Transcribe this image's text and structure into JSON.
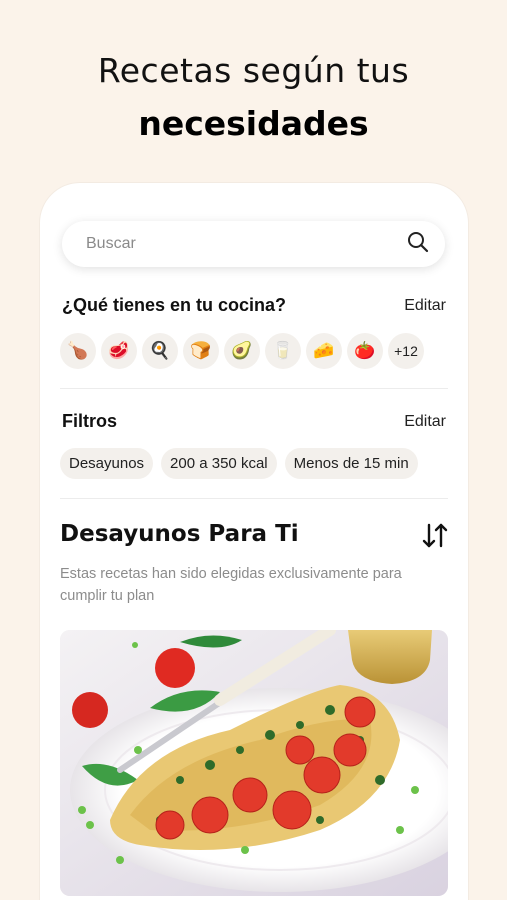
{
  "headline": {
    "line1": "Recetas según tus",
    "line2": "necesidades"
  },
  "search": {
    "placeholder": "Buscar"
  },
  "kitchen": {
    "title": "¿Qué tienes en tu cocina?",
    "edit_label": "Editar",
    "ingredients": [
      {
        "name": "chicken-leg-icon",
        "glyph": "🍗"
      },
      {
        "name": "meat-icon",
        "glyph": "🥩"
      },
      {
        "name": "egg-icon",
        "glyph": "🍳"
      },
      {
        "name": "bread-icon",
        "glyph": "🍞"
      },
      {
        "name": "avocado-icon",
        "glyph": "🥑"
      },
      {
        "name": "milk-glass-icon",
        "glyph": "🥛"
      },
      {
        "name": "cheese-icon",
        "glyph": "🧀"
      },
      {
        "name": "tomato-icon",
        "glyph": "🍅"
      }
    ],
    "more_label": "+12"
  },
  "filters": {
    "title": "Filtros",
    "edit_label": "Editar",
    "chips": [
      "Desayunos",
      "200 a 350 kcal",
      "Menos de 15 min"
    ]
  },
  "recommendations": {
    "title": "Desayunos Para Ti",
    "description": "Estas recetas han sido elegidas exclusivamente para cumplir tu plan",
    "sort_icon": "sort-icon"
  },
  "colors": {
    "background": "#fbf3ea",
    "card": "#ffffff",
    "chip": "#f3f0ec",
    "muted_text": "#8c8c8c"
  }
}
